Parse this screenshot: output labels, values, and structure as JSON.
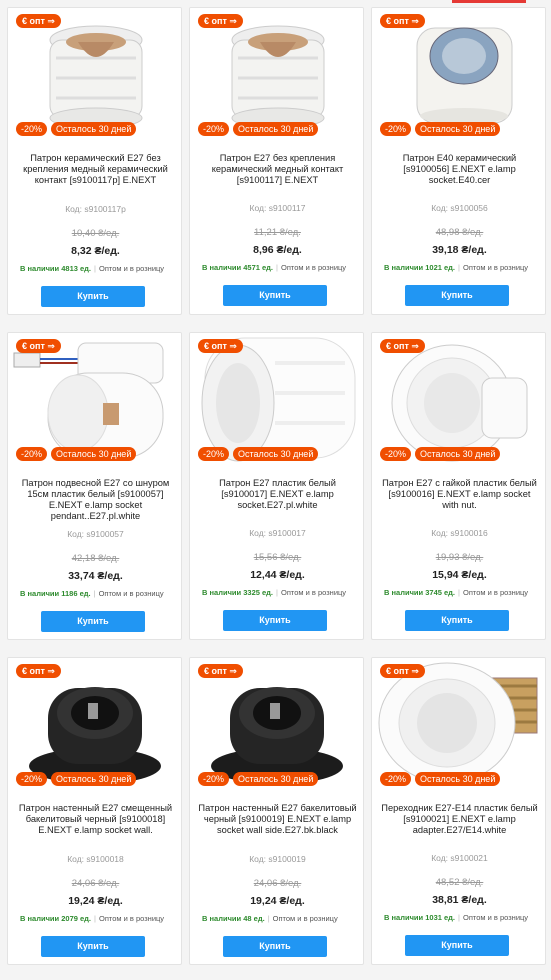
{
  "badges": {
    "opt": "€ опт ⇒",
    "discount": "-20%",
    "days_left": "Осталось 30 дней"
  },
  "buy_label": "Купить",
  "wholesale_text": "Оптом и в розницу",
  "colors": {
    "accent": "#f04e00",
    "buy": "#2196f3",
    "in_stock": "#2e8b2e"
  },
  "products": [
    {
      "title": "Патрон керамический E27 без крепления медный керамический контакт [s9100117p] E.NEXT",
      "code": "Код: s9100117p",
      "old_price": "10,40 ₴/ед.",
      "price": "8,32 ₴/ед.",
      "stock": "В наличии 4813 ед.",
      "icon": "ceramic-socket-icon"
    },
    {
      "title": "Патрон E27 без крепления керамический медный контакт [s9100117] E.NEXT",
      "code": "Код: s9100117",
      "old_price": "11,21 ₴/ед.",
      "price": "8,96 ₴/ед.",
      "stock": "В наличии 4571 ед.",
      "icon": "ceramic-socket-icon"
    },
    {
      "title": "Патрон E40 керамический [s9100056] E.NEXT e.lamp socket.E40.cer",
      "code": "Код: s9100056",
      "old_price": "48,98 ₴/ед.",
      "price": "39,18 ₴/ед.",
      "stock": "В наличии 1021 ед.",
      "icon": "ceramic-e40-socket-icon"
    },
    {
      "title": "Патрон подвесной E27 со шнуром 15см пластик белый [s9100057] E.NEXT e.lamp socket pendant..E27.pl.white",
      "code": "Код: s9100057",
      "old_price": "42,18 ₴/ед.",
      "price": "33,74 ₴/ед.",
      "stock": "В наличии 1186 ед.",
      "icon": "pendant-socket-icon"
    },
    {
      "title": "Патрон E27 пластик белый [s9100017] E.NEXT e.lamp socket.E27.pl.white",
      "code": "Код: s9100017",
      "old_price": "15,56 ₴/ед.",
      "price": "12,44 ₴/ед.",
      "stock": "В наличии 3325 ед.",
      "icon": "plastic-socket-icon"
    },
    {
      "title": "Патрон E27 с гайкой пластик белый [s9100016] E.NEXT e.lamp socket with nut.",
      "code": "Код: s9100016",
      "old_price": "19,93 ₴/ед.",
      "price": "15,94 ₴/ед.",
      "stock": "В наличии 3745 ед.",
      "icon": "plastic-nut-socket-icon"
    },
    {
      "title": "Патрон настенный E27 смещенный бакелитовый черный [s9100018] E.NEXT e.lamp socket wall.",
      "code": "Код: s9100018",
      "old_price": "24,06 ₴/ед.",
      "price": "19,24 ₴/ед.",
      "stock": "В наличии 2079 ед.",
      "icon": "wall-socket-black-icon"
    },
    {
      "title": "Патрон настенный E27 бакелитовый черный [s9100019] E.NEXT e.lamp socket wall side.E27.bk.black",
      "code": "Код: s9100019",
      "old_price": "24,06 ₴/ед.",
      "price": "19,24 ₴/ед.",
      "stock": "В наличии 48 ед.",
      "icon": "wall-socket-black-icon"
    },
    {
      "title": "Переходник E27-E14 пластик белый [s9100021] E.NEXT e.lamp adapter.E27/E14.white",
      "code": "Код: s9100021",
      "old_price": "48,52 ₴/ед.",
      "price": "38,81 ₴/ед.",
      "stock": "В наличии 1031 ед.",
      "icon": "adapter-e27-e14-icon"
    }
  ]
}
